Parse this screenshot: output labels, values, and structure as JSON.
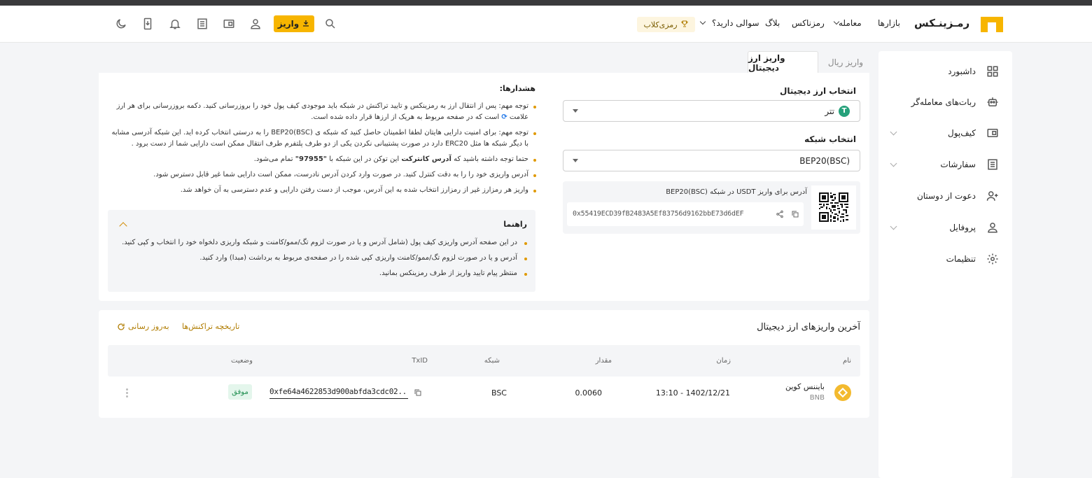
{
  "header": {
    "logo_text": "رمـزینـکس",
    "nav": {
      "markets": "بازارها",
      "trade": "معامله",
      "ramzinex": "رمزناکس",
      "blog": "بلاگ",
      "faq": "سوالی دارید؟"
    },
    "club_label": "رمزی‌کلاب",
    "deposit_label": "واریز"
  },
  "sidebar": {
    "items": [
      {
        "label": "داشبورد",
        "icon": "dashboard-icon"
      },
      {
        "label": "ربات‌های معامله‌گر",
        "icon": "robot-icon"
      },
      {
        "label": "کیف‌پول",
        "icon": "wallet-icon"
      },
      {
        "label": "سفارشات",
        "icon": "orders-icon"
      },
      {
        "label": "دعوت از دوستان",
        "icon": "invite-icon"
      },
      {
        "label": "پروفایل",
        "icon": "profile-icon"
      },
      {
        "label": "تنظیمات",
        "icon": "settings-icon"
      }
    ]
  },
  "tabs": {
    "active": "واریز ارز دیجیتال",
    "inactive": "واریز ریال"
  },
  "form": {
    "currency_label": "انتخاب ارز دیجیتال",
    "currency_value": "تتر",
    "network_label": "انتخاب شبکه",
    "network_value": "BEP20(BSC)",
    "address_title": "آدرس برای واریز USDT در شبکه BEP20(BSC)",
    "address_value": "0x55419ECD39fB2483A5Ef83756d9162bbE73d6dEF"
  },
  "warnings": {
    "title": "هشدارها:",
    "items": [
      "توجه مهم: پس از انتقال ارز به رمزینکس و تایید تراکنش در شبکه باید موجودی کیف پول خود را بروزرسانی کنید. دکمه بروزرسانی برای هر ارز علامت",
      "است که در صفحه مربوط به هریک از ارزها قرار داده شده است.",
      "توجه مهم: برای امنیت دارایی هایتان لطفا اطمینان حاصل کنید که شبکه ی BEP20(BSC) را به درستی انتخاب کرده اید. این شبکه آدرسی مشابه با دیگر شبکه ها مثل ERC20 دارد در صورت پشتیبانی نکردن یکی از دو طرف پلتفرم طرف انتقال ممکن است دارایی شما از دست برود .",
      "حتما توجه داشته باشید که",
      "آدرس کانترکت",
      "این توکن در این شبکه با",
      "\"97955\"",
      "تمام می‌شود.",
      "آدرس واریزی خود را را به دقت کنترل کنید. در صورت وارد کردن آدرس نادرست، ممکن است دارایی شما غیر قابل دسترس شود.",
      "واریز هر رمزارز غیر از رمزارز انتخاب شده به این آدرس، موجب از دست رفتن دارایی و عدم دسترسی به آن خواهد شد."
    ]
  },
  "guide": {
    "title": "راهنما",
    "items": [
      "در این صفحه آدرس واریزی کیف پول (شامل آدرس و یا در صورت لزوم تگ/ممو/کامنت و شبکه واریزی دلخواه خود را انتخاب و کپی کنید.",
      "آدرس و یا در صورت لزوم تگ/ممو/کامنت واریزی کپی شده را در صفحه‌ی مربوط به برداشت (مبدا) وارد کنید.",
      "منتظر پیام تایید واریز از طرف رمزینکس بمانید."
    ]
  },
  "history": {
    "title": "آخرین واریزهای ارز دیجیتال",
    "history_link": "تاریخچه تراکنش‌ها",
    "refresh_link": "به‌روز رسانی",
    "columns": [
      "نام",
      "زمان",
      "مقدار",
      "شبکه",
      "TxID",
      "وضعیت"
    ],
    "rows": [
      {
        "name": "بایننس کوین",
        "symbol": "BNB",
        "time": "13:10 - 1402/12/21",
        "amount": "0.0060",
        "network": "BSC",
        "txid": "0xfe64a4622853d900abfda3cdc02...",
        "status": "موفق"
      }
    ]
  },
  "colors": {
    "accent": "#f7b500",
    "success": "#1e8e4f"
  }
}
